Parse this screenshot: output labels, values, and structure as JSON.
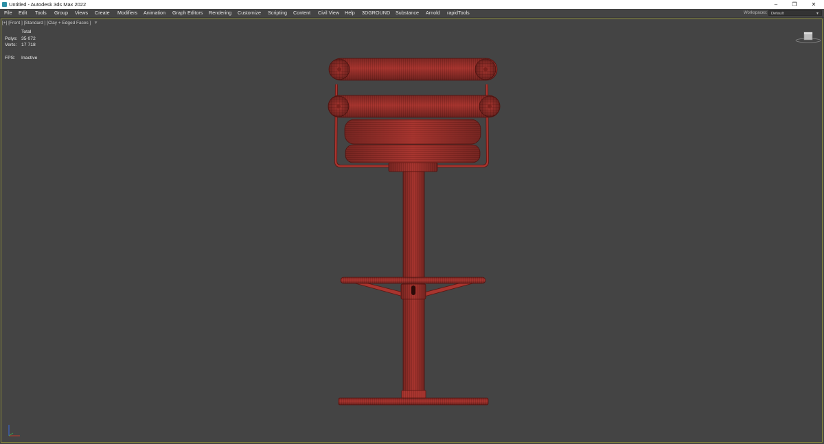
{
  "window": {
    "title": "Untitled - Autodesk 3ds Max 2022",
    "controls": [
      "–",
      "❐",
      "✕"
    ]
  },
  "menubar": {
    "items": [
      "File",
      "Edit",
      "Tools",
      "Group",
      "Views",
      "Create",
      "Modifiers",
      "Animation",
      "Graph Editors",
      "Rendering",
      "Customize",
      "Scripting",
      "Content",
      "Civil View",
      "Help",
      "3DGROUND",
      "Substance",
      "Arnold",
      "rapidTools"
    ],
    "workspaces_label": "Workspaces:",
    "workspace_value": "Default"
  },
  "viewport": {
    "label": "[+] [Front ] [Standard ] [Clay + Edged Faces ]",
    "stats": {
      "total_label": "Total",
      "polys_label": "Polys:",
      "polys_value": "35 072",
      "verts_label": "Verts:",
      "verts_value": "17 718",
      "fps_label": "FPS:",
      "fps_value": "Inactive"
    }
  },
  "colors": {
    "viewport_bg": "#444444",
    "model_fill": "#a8352f",
    "wire": "#5a1612",
    "viewport_border": "#8f8f3a"
  },
  "icons": [
    "app-icon",
    "funnel-icon",
    "viewcube-icon",
    "axis-tripod-icon",
    "chevron-down-icon"
  ]
}
